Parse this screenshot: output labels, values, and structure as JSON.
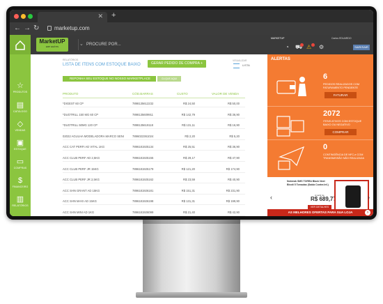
{
  "browser": {
    "url": "marketup.com",
    "colors": {
      "close": "#ff5f57",
      "minimize": "#febc2e",
      "maximize": "#28c840"
    }
  },
  "app": {
    "logo_main": "MarketUP",
    "logo_sub": "ERP GRÁTIS",
    "search_placeholder": "PROCURE POR...",
    "accent": "#8bc53f",
    "sidebar": [
      {
        "label": "PRODUTOS",
        "icon": "star-icon"
      },
      {
        "label": "CATÁLOGO",
        "icon": "cart-icon"
      },
      {
        "label": "VENDAS",
        "icon": "tag-icon"
      },
      {
        "label": "ESTOQUE",
        "icon": "box-icon"
      },
      {
        "label": "COMPRAS",
        "icon": "truck-icon"
      },
      {
        "label": "FINANCEIRO",
        "icon": "money-bag-icon"
      },
      {
        "label": "RELATÓRIOS",
        "icon": "bar-chart-icon"
      }
    ]
  },
  "page": {
    "section_label": "RELATÓRIOS",
    "title": "LISTA DE ITENS COM ESTOQUE BAIXO",
    "generate_button": "GERAR PEDIDO DE COMPRA  +",
    "sort_label": "VISUALIZAR",
    "sort_value": "LISTA",
    "banner_text": "REPONHA SEU ESTOQUE NO NOSSO MARKETPLACE",
    "banner_button": "CLIQUE AQUI"
  },
  "table": {
    "headers": [
      "PRODUTO",
      "CÓD.BARRAS",
      "CUSTO",
      "VALOR DE VENDA"
    ],
    "rows": [
      [
        "*DIGEST 60 CP",
        "7898135612232",
        "R$ 24,50",
        "R$ 50,00"
      ],
      [
        "*DUOTRILL 150 MG 60 CP",
        "7898135609911",
        "R$ 142,79",
        "R$ 36,90"
      ],
      [
        "*DUOTRILL 50MG 120 CP",
        "7898135619118",
        "R$ 131,11",
        "R$ 16,90"
      ],
      [
        "02022 AGULHA MODELADORA MARCO SENI",
        "7896022361024",
        "R$ 2,20",
        "R$ 5,20"
      ],
      [
        "ACC CAT PERFI AD VITAL 1KG",
        "7896181925134",
        "R$ 25,51",
        "R$ 36,90"
      ],
      [
        "ACC CLUB PERF AD 2,5KG",
        "7896181925155",
        "R$ 29,17",
        "R$ 47,90"
      ],
      [
        "ACC CLUB PERF JR 15KG",
        "7896181925179",
        "R$ 121,20",
        "R$ 174,90"
      ],
      [
        "ACC CLUB PERF JR 2,5KG",
        "7896181925162",
        "R$ 23,59",
        "R$ 40,90"
      ],
      [
        "ACC SHN GRANT AD 15KG",
        "7896181926181",
        "R$ 151,31",
        "R$ 231,90"
      ],
      [
        "ACC SHN MAXI AD 15KG",
        "7896181926198",
        "R$ 131,31",
        "R$ 199,90"
      ],
      [
        "ACC SHN MINI AD 1KG",
        "7896181926099",
        "R$ 21,40",
        "R$ 42,90"
      ],
      [
        "ACC SHN MINI AD 2,5KG",
        "7896181925117",
        "R$ 53,58",
        "R$ 42,90"
      ],
      [
        "ACC SHN MINI IND AD 2,5KG",
        "7896181925123",
        "R$ 52,99",
        "R$ 109,90"
      ]
    ]
  },
  "alerts_panel": {
    "topbar_title": "MARKETUP",
    "user": "Carlos EDUARDO",
    "exit_button": "SAIR/SAIR",
    "title": "ALERTAS",
    "accent": "#f47b32",
    "items": [
      {
        "count": "6",
        "description": "PEDIDOS REALIZADOS COM FATURAMENTO PENDENTE",
        "button": "FATURAR"
      },
      {
        "count": "2072",
        "description": "ITENS ATIVOS COM ESTOQUE BAIXO OU NEGATIVO",
        "button": "COMPRAR"
      },
      {
        "count": "0",
        "description": "CONTINGÊNCIA DE NFC-e COM TRANSMISSÃO NÃO REALIZADA",
        "button": ""
      }
    ],
    "ad": {
      "title": "Nobreak SMS TORRA Black Next Bivolt 5 Tomadas (Saída Contra Inf.)",
      "price_label": "A partir de",
      "price": "R$ 689,77",
      "button": "VER DETALHES"
    },
    "offers_bar": "AS MELHORES OFERTAS PARA SUA LOJA"
  }
}
